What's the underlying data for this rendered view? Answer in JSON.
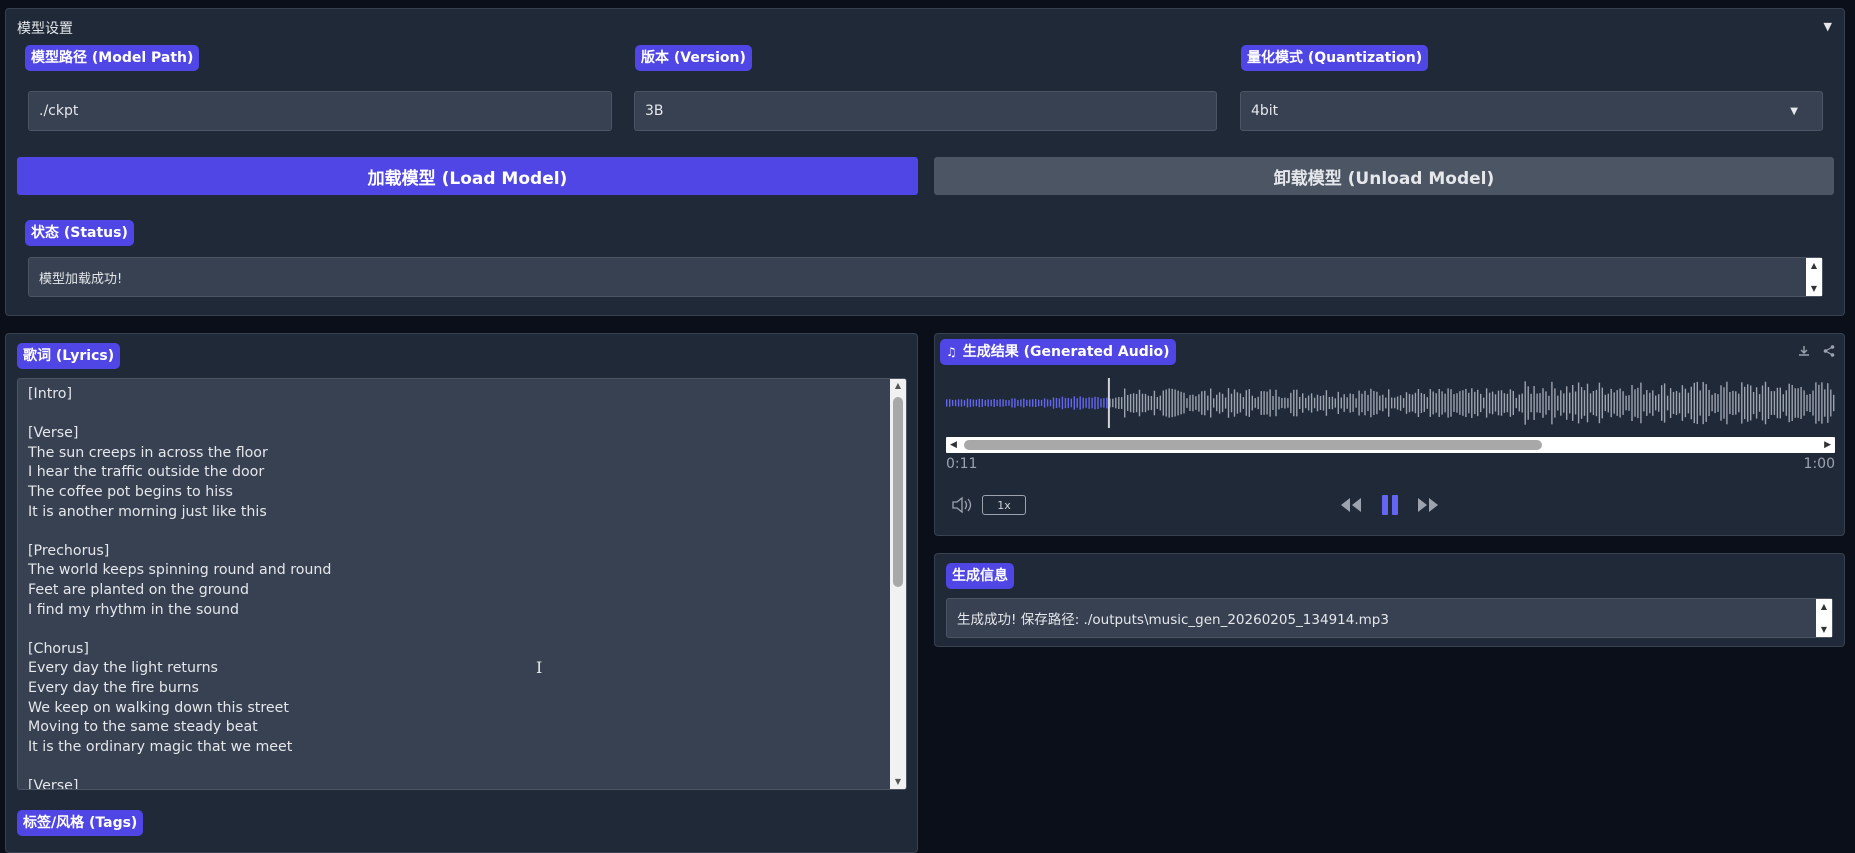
{
  "settings": {
    "title": "模型设置",
    "toggle": "▼",
    "model_path": {
      "label": "模型路径 (Model Path)",
      "value": "./ckpt"
    },
    "version": {
      "label": "版本 (Version)",
      "value": "3B"
    },
    "quantization": {
      "label": "量化模式 (Quantization)",
      "value": "4bit"
    },
    "load_button": "加载模型 (Load Model)",
    "unload_button": "卸载模型 (Unload Model)",
    "status": {
      "label": "状态 (Status)",
      "value": "模型加载成功!"
    }
  },
  "lyrics": {
    "label": "歌词 (Lyrics)",
    "text": "[Intro]\n\n[Verse]\nThe sun creeps in across the floor\nI hear the traffic outside the door\nThe coffee pot begins to hiss\nIt is another morning just like this\n\n[Prechorus]\nThe world keeps spinning round and round\nFeet are planted on the ground\nI find my rhythm in the sound\n\n[Chorus]\nEvery day the light returns\nEvery day the fire burns\nWe keep on walking down this street\nMoving to the same steady beat\nIt is the ordinary magic that we meet\n\n[Verse]"
  },
  "tags": {
    "label": "标签/风格 (Tags)"
  },
  "audio": {
    "label": "生成结果 (Generated Audio)",
    "current_time": "0:11",
    "duration": "1:00",
    "speed": "1x",
    "progress": 0.183
  },
  "info": {
    "label": "生成信息",
    "value": "生成成功! 保存路径: ./outputs\\music_gen_20260205_134914.mp3"
  },
  "colors": {
    "accent": "#4f46e5",
    "played_wave": "#6366f1",
    "unplayed_wave": "#9ca3af"
  }
}
